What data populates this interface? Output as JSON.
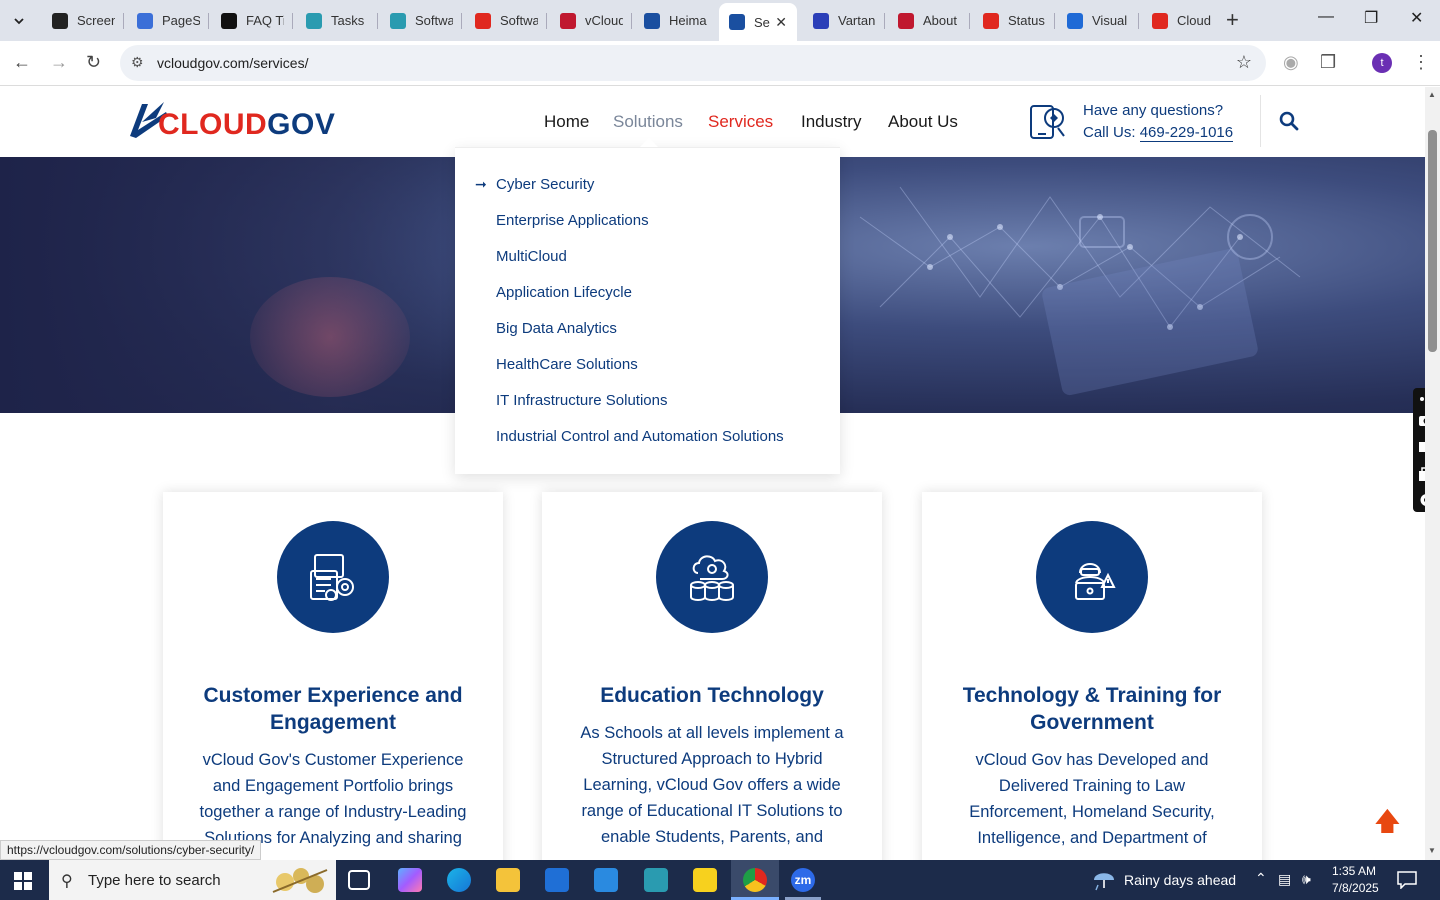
{
  "browser": {
    "tabs": [
      {
        "title": "Screen",
        "color": "#222222"
      },
      {
        "title": "PageSp",
        "color": "#3b6fd8"
      },
      {
        "title": "FAQ Ti",
        "color": "#111111"
      },
      {
        "title": "Tasks",
        "color": "#2a9bb0"
      },
      {
        "title": "Softwa",
        "color": "#2a9bb0"
      },
      {
        "title": "Softwa",
        "color": "#e0281f"
      },
      {
        "title": "vCloud",
        "color": "#c0182f"
      },
      {
        "title": "Heima",
        "color": "#1a4fa0"
      },
      {
        "title": "Se",
        "color": "#1a4fa0",
        "active": true
      },
      {
        "title": "Vartan",
        "color": "#2b3fb8"
      },
      {
        "title": "About",
        "color": "#c0182f"
      },
      {
        "title": "Status",
        "color": "#e0281f"
      },
      {
        "title": "Visual",
        "color": "#1f6ad6"
      },
      {
        "title": "Cloud",
        "color": "#e0281f"
      }
    ],
    "url": "vcloudgov.com/services/",
    "profile_initial": "t",
    "status_url": "https://vcloudgov.com/solutions/cyber-security/"
  },
  "site": {
    "logo_text_1": "CLOUD",
    "logo_text_2": "GOV",
    "nav": [
      "Home",
      "Solutions",
      "Services",
      "Industry",
      "About Us"
    ],
    "contact_question": "Have any questions?",
    "contact_prefix": "Call Us: ",
    "contact_phone": "469-229-1016",
    "dropdown": [
      "Cyber Security",
      "Enterprise Applications",
      "MultiCloud",
      "Application Lifecycle",
      "Big Data Analytics",
      "HealthCare Solutions",
      "IT Infrastructure Solutions",
      "Industrial Control and Automation Solutions"
    ],
    "cards": [
      {
        "title": "Customer Experience and Engagement",
        "lines": [
          "vCloud Gov's Customer Experience",
          "and Engagement Portfolio brings",
          "together a range of Industry-Leading",
          "Solutions for Analyzing and sharing"
        ]
      },
      {
        "title": "Education Technology",
        "lines": [
          "As Schools at all levels implement a",
          "Structured Approach to Hybrid",
          "Learning, vCloud Gov offers a wide",
          "range of Educational IT Solutions to",
          "enable Students, Parents, and"
        ]
      },
      {
        "title": "Technology & Training for Government",
        "lines": [
          "vCloud Gov has Developed and",
          "Delivered Training to Law",
          "Enforcement, Homeland Security,",
          "Intelligence, and Department of"
        ]
      }
    ]
  },
  "taskbar": {
    "search_placeholder": "Type here to search",
    "weather": "Rainy days ahead",
    "time": "1:35 AM",
    "date": "7/8/2025",
    "zoom_label": "zm"
  }
}
